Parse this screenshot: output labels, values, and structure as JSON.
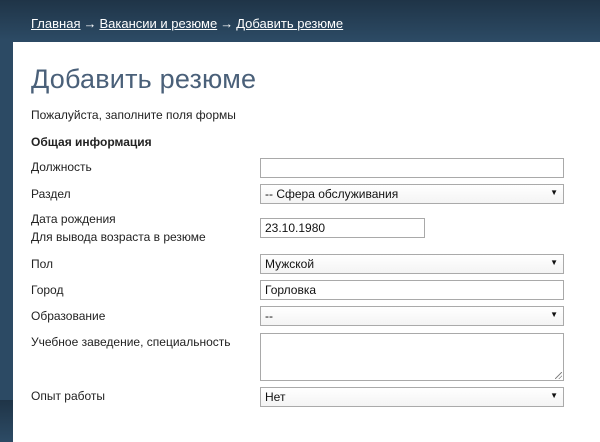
{
  "breadcrumb": {
    "items": [
      "Главная",
      "Вакансии и резюме",
      "Добавить резюме"
    ],
    "separator": "→"
  },
  "page": {
    "title": "Добавить резюме",
    "note": "Пожалуйста, заполните поля формы",
    "section_title": "Общая информация"
  },
  "form": {
    "position": {
      "label": "Должность",
      "value": ""
    },
    "category": {
      "label": "Раздел",
      "value": "-- Сфера обслуживания"
    },
    "birth_date": {
      "label": "Дата рождения",
      "sublabel": "Для вывода возраста в резюме",
      "value": "23.10.1980"
    },
    "gender": {
      "label": "Пол",
      "value": "Мужской"
    },
    "city": {
      "label": "Город",
      "value": "Горловка"
    },
    "education": {
      "label": "Образование",
      "value": "--"
    },
    "institution": {
      "label": "Учебное заведение, специальность",
      "value": ""
    },
    "experience": {
      "label": "Опыт работы",
      "value": "Нет"
    }
  },
  "colors": {
    "header_bg": "#2c4a64",
    "title": "#4a6079"
  }
}
